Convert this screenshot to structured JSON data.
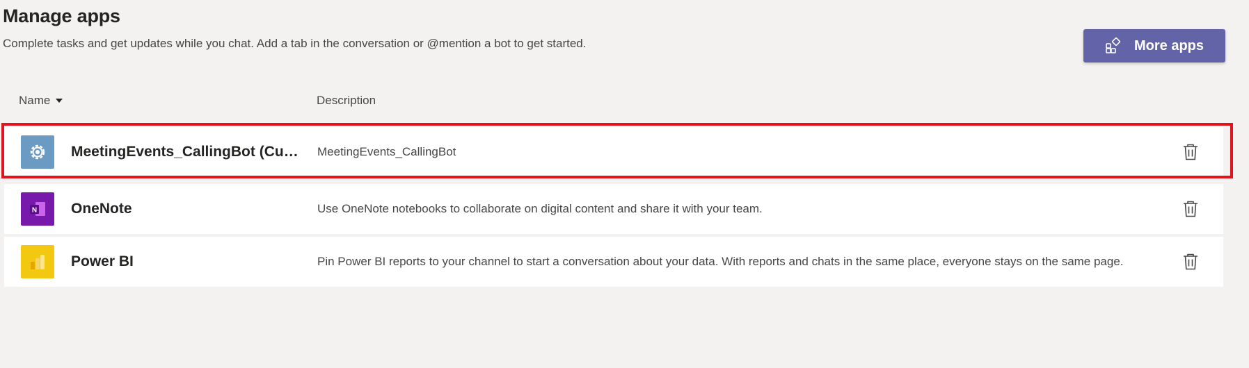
{
  "header": {
    "title": "Manage apps",
    "subtitle": "Complete tasks and get updates while you chat. Add a tab in the conversation or @mention a bot to get started."
  },
  "toolbar": {
    "more_apps_label": "More apps",
    "more_apps_icon": "apps-add-icon"
  },
  "table": {
    "columns": {
      "name": "Name",
      "description": "Description"
    },
    "rows": [
      {
        "name": "MeetingEvents_CallingBot (Custom)",
        "description": "MeetingEvents_CallingBot",
        "icon": "gear-icon",
        "icon_bg": "#6b9bc3",
        "highlighted": true
      },
      {
        "name": "OneNote",
        "description": "Use OneNote notebooks to collaborate on digital content and share it with your team.",
        "icon": "onenote-icon",
        "icon_bg": "#7719aa"
      },
      {
        "name": "Power BI",
        "description": "Pin Power BI reports to your channel to start a conversation about your data. With reports and chats in the same place, everyone stays on the same page.",
        "icon": "powerbi-icon",
        "icon_bg": "#f2c811"
      }
    ]
  },
  "colors": {
    "accent": "#6264a7",
    "highlight": "#e0141e",
    "background": "#f3f2f1"
  }
}
